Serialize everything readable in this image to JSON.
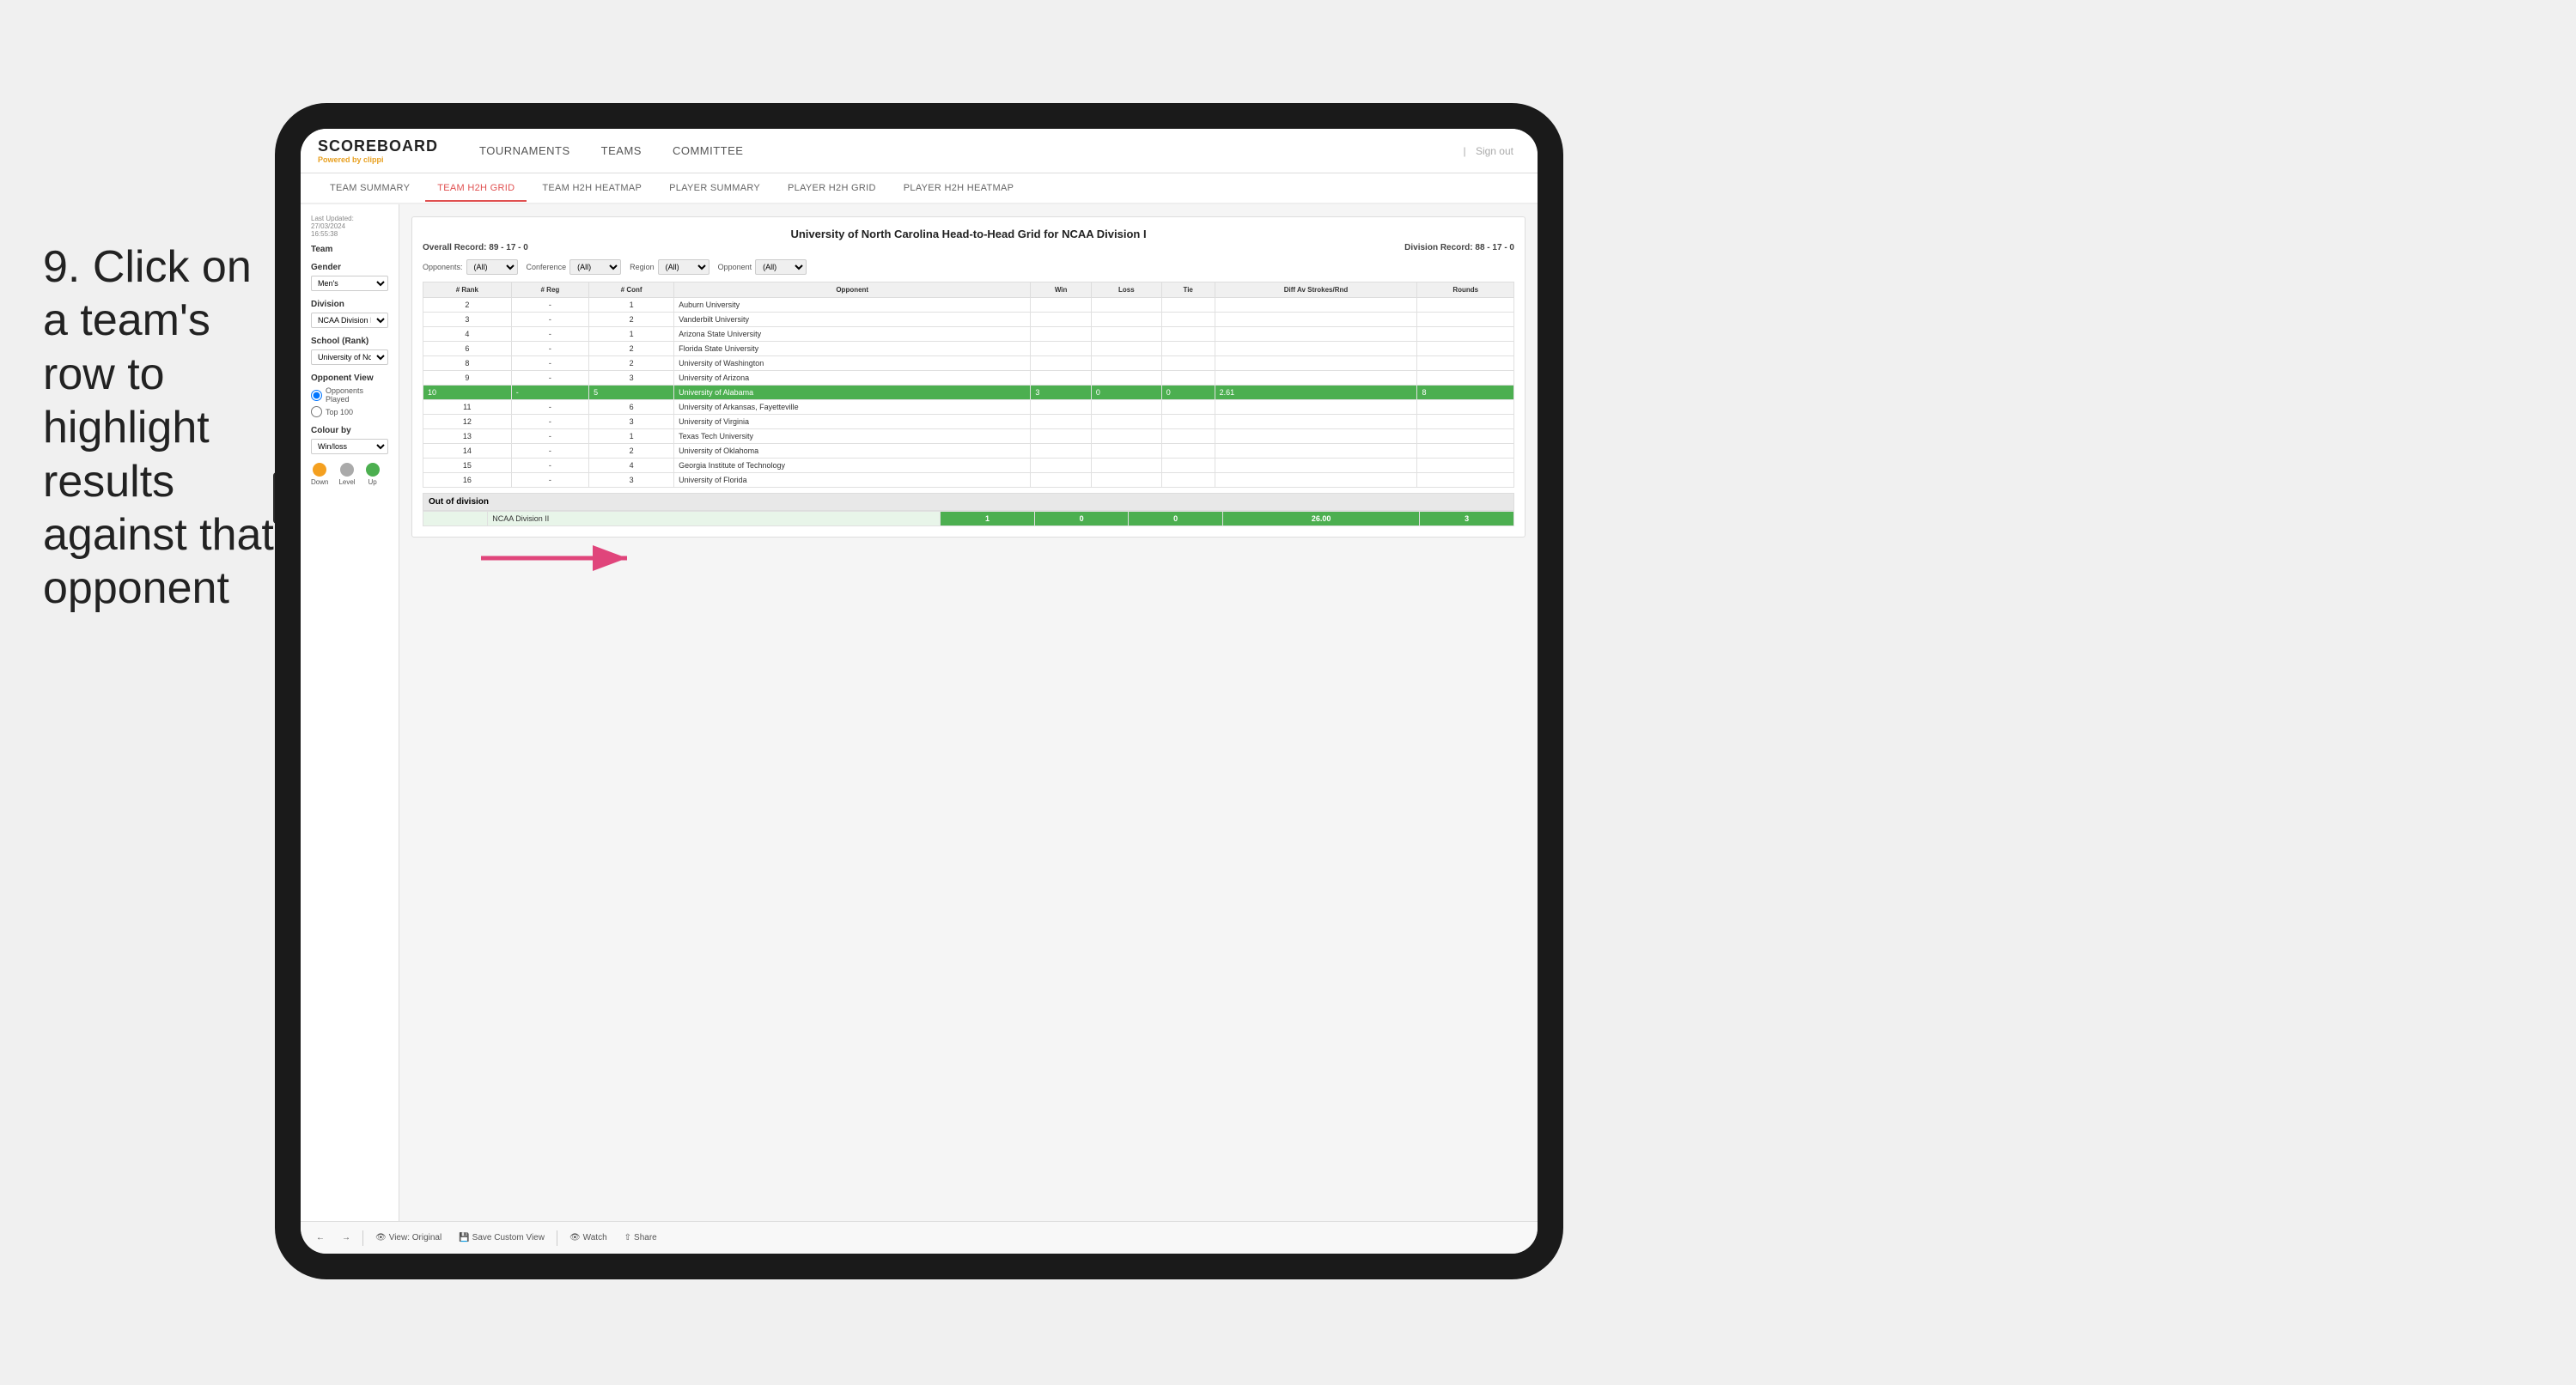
{
  "instruction": {
    "step": "9.",
    "text": "Click on a team's row to highlight results against that opponent"
  },
  "tablet": {
    "nav": {
      "logo": "SCOREBOARD",
      "logo_sub": "Powered by",
      "logo_brand": "clippi",
      "items": [
        "TOURNAMENTS",
        "TEAMS",
        "COMMITTEE"
      ],
      "sign_out": "Sign out"
    },
    "sub_nav": {
      "items": [
        "TEAM SUMMARY",
        "TEAM H2H GRID",
        "TEAM H2H HEATMAP",
        "PLAYER SUMMARY",
        "PLAYER H2H GRID",
        "PLAYER H2H HEATMAP"
      ],
      "active": "TEAM H2H GRID"
    },
    "sidebar": {
      "updated_label": "Last Updated: 27/03/2024",
      "updated_time": "16:55:38",
      "team_label": "Team",
      "gender_label": "Gender",
      "gender_value": "Men's",
      "division_label": "Division",
      "division_value": "NCAA Division I",
      "school_label": "School (Rank)",
      "school_value": "University of Nort...",
      "opponent_view_label": "Opponent View",
      "opponents_played": "Opponents Played",
      "top100": "Top 100",
      "colour_by_label": "Colour by",
      "colour_by_value": "Win/loss",
      "legend": {
        "down_label": "Down",
        "level_label": "Level",
        "up_label": "Up"
      }
    },
    "grid": {
      "title": "University of North Carolina Head-to-Head Grid for NCAA Division I",
      "overall_record_label": "Overall Record:",
      "overall_record": "89 - 17 - 0",
      "division_record_label": "Division Record:",
      "division_record": "88 - 17 - 0",
      "filters": {
        "opponents_label": "Opponents:",
        "opponents_value": "(All)",
        "conference_label": "Conference",
        "conference_value": "(All)",
        "region_label": "Region",
        "region_value": "(All)",
        "opponent_label": "Opponent",
        "opponent_value": "(All)"
      },
      "columns": [
        "# Rank",
        "# Reg",
        "# Conf",
        "Opponent",
        "Win",
        "Loss",
        "Tie",
        "Diff Av Strokes/Rnd",
        "Rounds"
      ],
      "rows": [
        {
          "rank": "2",
          "reg": "-",
          "conf": "1",
          "opponent": "Auburn University",
          "win": "",
          "loss": "",
          "tie": "",
          "diff": "",
          "rounds": "",
          "highlight": false,
          "row_class": ""
        },
        {
          "rank": "3",
          "reg": "-",
          "conf": "2",
          "opponent": "Vanderbilt University",
          "win": "",
          "loss": "",
          "tie": "",
          "diff": "",
          "rounds": "",
          "highlight": false,
          "row_class": ""
        },
        {
          "rank": "4",
          "reg": "-",
          "conf": "1",
          "opponent": "Arizona State University",
          "win": "",
          "loss": "",
          "tie": "",
          "diff": "",
          "rounds": "",
          "highlight": false,
          "row_class": ""
        },
        {
          "rank": "6",
          "reg": "-",
          "conf": "2",
          "opponent": "Florida State University",
          "win": "",
          "loss": "",
          "tie": "",
          "diff": "",
          "rounds": "",
          "highlight": false,
          "row_class": ""
        },
        {
          "rank": "8",
          "reg": "-",
          "conf": "2",
          "opponent": "University of Washington",
          "win": "",
          "loss": "",
          "tie": "",
          "diff": "",
          "rounds": "",
          "highlight": false,
          "row_class": ""
        },
        {
          "rank": "9",
          "reg": "-",
          "conf": "3",
          "opponent": "University of Arizona",
          "win": "",
          "loss": "",
          "tie": "",
          "diff": "",
          "rounds": "",
          "highlight": false,
          "row_class": ""
        },
        {
          "rank": "10",
          "reg": "-",
          "conf": "5",
          "opponent": "University of Alabama",
          "win": "3",
          "loss": "0",
          "tie": "0",
          "diff": "2.61",
          "rounds": "8",
          "highlight": true,
          "row_class": "highlighted"
        },
        {
          "rank": "11",
          "reg": "-",
          "conf": "6",
          "opponent": "University of Arkansas, Fayetteville",
          "win": "",
          "loss": "",
          "tie": "",
          "diff": "",
          "rounds": "",
          "highlight": false,
          "row_class": ""
        },
        {
          "rank": "12",
          "reg": "-",
          "conf": "3",
          "opponent": "University of Virginia",
          "win": "",
          "loss": "",
          "tie": "",
          "diff": "",
          "rounds": "",
          "highlight": false,
          "row_class": ""
        },
        {
          "rank": "13",
          "reg": "-",
          "conf": "1",
          "opponent": "Texas Tech University",
          "win": "",
          "loss": "",
          "tie": "",
          "diff": "",
          "rounds": "",
          "highlight": false,
          "row_class": ""
        },
        {
          "rank": "14",
          "reg": "-",
          "conf": "2",
          "opponent": "University of Oklahoma",
          "win": "",
          "loss": "",
          "tie": "",
          "diff": "",
          "rounds": "",
          "highlight": false,
          "row_class": ""
        },
        {
          "rank": "15",
          "reg": "-",
          "conf": "4",
          "opponent": "Georgia Institute of Technology",
          "win": "",
          "loss": "",
          "tie": "",
          "diff": "",
          "rounds": "",
          "highlight": false,
          "row_class": ""
        },
        {
          "rank": "16",
          "reg": "-",
          "conf": "3",
          "opponent": "University of Florida",
          "win": "",
          "loss": "",
          "tie": "",
          "diff": "",
          "rounds": "",
          "highlight": false,
          "row_class": ""
        }
      ],
      "out_of_division_label": "Out of division",
      "out_of_division_row": {
        "division": "NCAA Division II",
        "win": "1",
        "loss": "0",
        "tie": "0",
        "diff": "26.00",
        "rounds": "3"
      }
    },
    "toolbar": {
      "view_label": "View: Original",
      "save_label": "Save Custom View",
      "watch_label": "Watch",
      "share_label": "Share"
    }
  }
}
